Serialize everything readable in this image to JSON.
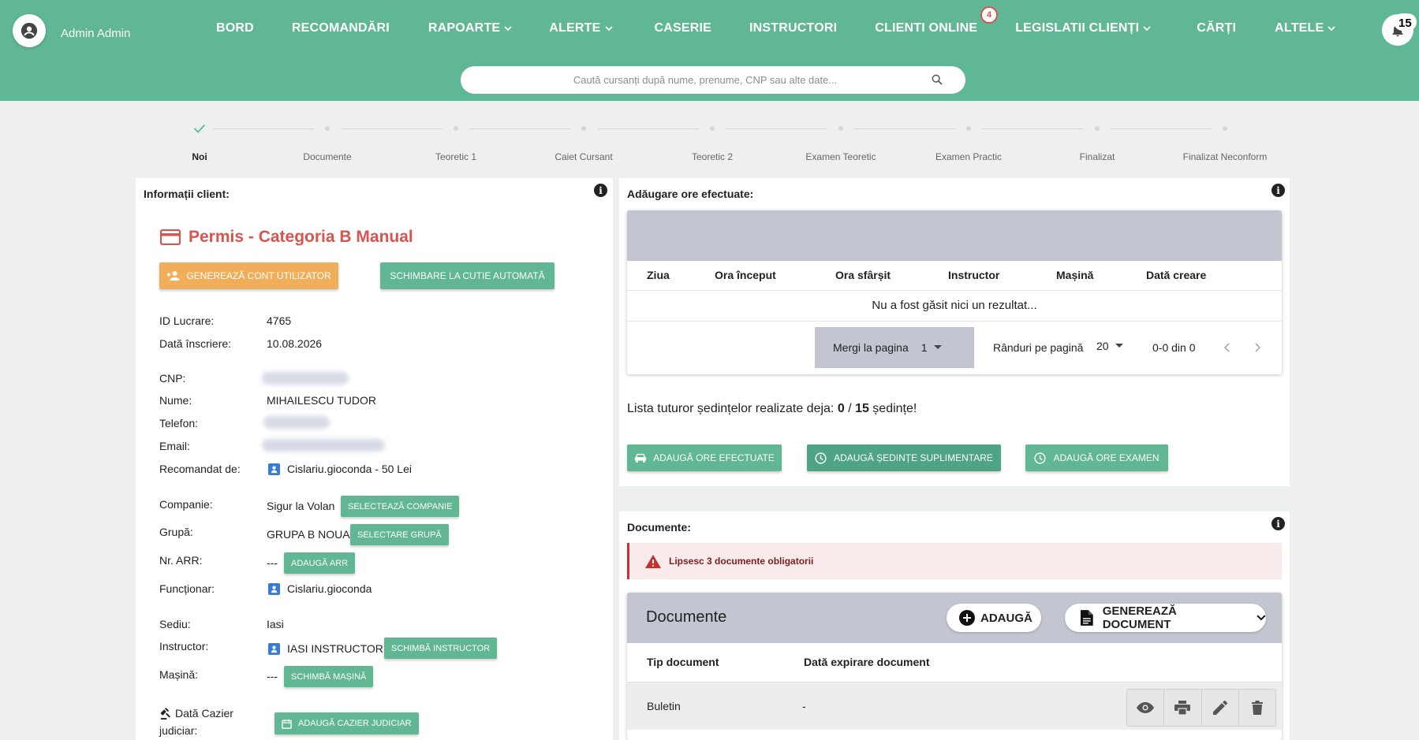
{
  "header": {
    "user_name": "Admin Admin",
    "nav": [
      {
        "label": "BORD",
        "dropdown": false
      },
      {
        "label": "RECOMANDĂRI",
        "dropdown": false
      },
      {
        "label": "RAPOARTE",
        "dropdown": true
      },
      {
        "label": "ALERTE",
        "dropdown": true
      },
      {
        "label": "CASERIE",
        "dropdown": false
      },
      {
        "label": "INSTRUCTORI",
        "dropdown": false
      },
      {
        "label": "CLIENTI ONLINE",
        "dropdown": false,
        "badge": "4"
      },
      {
        "label": "LEGISLATII CLIENȚI",
        "dropdown": true
      },
      {
        "label": "CĂRȚI",
        "dropdown": false
      },
      {
        "label": "ALTELE",
        "dropdown": true
      }
    ],
    "notifications_count": "15",
    "search_placeholder": "Caută cursanți după nume, prenume, CNP sau alte date..."
  },
  "stepper": {
    "steps": [
      "Noi",
      "Documente",
      "Teoretic 1",
      "Caiet Cursant",
      "Teoretic 2",
      "Examen Teoretic",
      "Examen Practic",
      "Finalizat",
      "Finalizat Neconform"
    ],
    "active_index": 0
  },
  "client_info": {
    "title": "Informații client:",
    "permis_title": "Permis - Categoria B Manual",
    "btn_generate_account": "GENEREAZĂ CONT UTILIZATOR",
    "btn_change_gearbox": "SCHIMBARE LA CUTIE AUTOMATĂ",
    "labels": {
      "id_lucrare": "ID Lucrare:",
      "data_inscriere": "Dată înscriere:",
      "cnp": "CNP:",
      "nume": "Nume:",
      "telefon": "Telefon:",
      "email": "Email:",
      "recomandat": "Recomandat de:",
      "companie": "Companie:",
      "grupa": "Grupă:",
      "nr_arr": "Nr. ARR:",
      "functionar": "Funcționar:",
      "sediu": "Sediu:",
      "instructor": "Instructor:",
      "masina": "Mașină:",
      "cazier_1": "Dată Cazier",
      "cazier_2": "judiciar:"
    },
    "values": {
      "id_lucrare": "4765",
      "data_inscriere": "10.08.2026",
      "nume": "MIHAILESCU TUDOR",
      "recomandat": "Cislariu.gioconda - 50 Lei",
      "companie": "Sigur la Volan",
      "grupa": "GRUPA B NOUA",
      "nr_arr": "---",
      "functionar": "Cislariu.gioconda",
      "sediu": "Iasi",
      "instructor": "IASI INSTRUCTOR",
      "masina": "---"
    },
    "buttons": {
      "select_company": "SELECTEAZĂ COMPANIE",
      "select_group": "SELECTARE GRUPĂ",
      "add_arr": "ADAUGĂ ARR",
      "change_instructor": "SCHIMBĂ INSTRUCTOR",
      "change_car": "SCHIMBĂ MAȘINĂ",
      "add_cazier": "ADAUGĂ CAZIER JUDICIAR"
    }
  },
  "hours": {
    "title": "Adăugare ore efectuate:",
    "columns": [
      "Ziua",
      "Ora început",
      "Ora sfârșit",
      "Instructor",
      "Mașină",
      "Dată creare"
    ],
    "empty_text": "Nu a fost găsit nici un rezultat...",
    "goto_page_label": "Mergi la pagina",
    "goto_page_value": "1",
    "rows_per_page_label": "Rânduri pe pagină",
    "rows_per_page_value": "20",
    "range_text": "0-0 din 0",
    "sessions_prefix": "Lista tuturor ședințelor realizate deja: ",
    "sessions_done": "0",
    "sessions_sep": " / ",
    "sessions_total": "15",
    "sessions_suffix": " ședințe!",
    "btn_add_hours": "ADAUGĂ ORE EFECTUATE",
    "btn_add_extra": "ADAUGĂ ȘEDINȚE SUPLIMENTARE",
    "btn_add_exam": "ADAUGĂ ORE EXAMEN"
  },
  "documents": {
    "title": "Documente:",
    "alert": "Lipsesc 3 documente obligatorii",
    "card_title": "Documente",
    "btn_add": "ADAUGĂ",
    "btn_generate": "GENEREAZĂ DOCUMENT",
    "columns": [
      "Tip document",
      "Dată expirare document"
    ],
    "rows": [
      {
        "type": "Buletin",
        "expiry": "-"
      }
    ]
  },
  "colors": {
    "header": "#5fb795",
    "accent_red": "#d9534f",
    "orange": "#f0ae5a",
    "green_button": "#61b793"
  }
}
